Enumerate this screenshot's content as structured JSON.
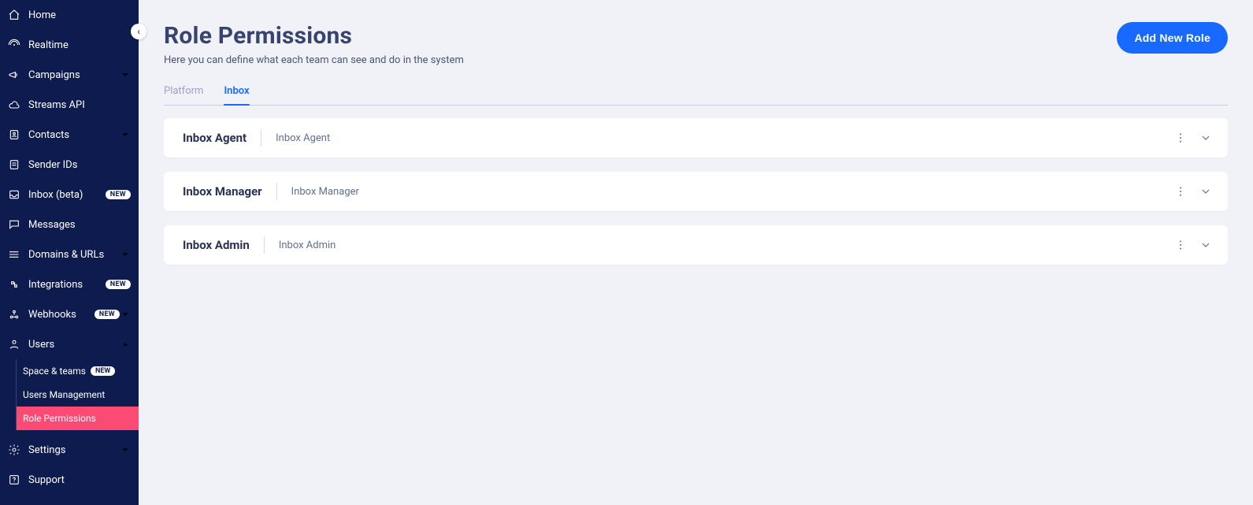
{
  "sidebar": {
    "collapse_icon": "‹",
    "items": [
      {
        "label": "Home",
        "icon": "home",
        "hasChevron": false
      },
      {
        "label": "Realtime",
        "icon": "realtime",
        "hasChevron": false
      },
      {
        "label": "Campaigns",
        "icon": "megaphone",
        "hasChevron": true
      },
      {
        "label": "Streams API",
        "icon": "cloud",
        "hasChevron": false
      },
      {
        "label": "Contacts",
        "icon": "contacts",
        "hasChevron": true
      },
      {
        "label": "Sender IDs",
        "icon": "sender",
        "hasChevron": false
      },
      {
        "label": "Inbox (beta)",
        "icon": "inbox",
        "hasChevron": false,
        "badge": "NEW"
      },
      {
        "label": "Messages",
        "icon": "messages",
        "hasChevron": false
      },
      {
        "label": "Domains & URLs",
        "icon": "domains",
        "hasChevron": true
      },
      {
        "label": "Integrations",
        "icon": "integrations",
        "hasChevron": false,
        "badge": "NEW"
      },
      {
        "label": "Webhooks",
        "icon": "webhooks",
        "hasChevron": true,
        "badge": "NEW"
      },
      {
        "label": "Users",
        "icon": "users",
        "hasChevron": true,
        "expanded": true,
        "children": [
          {
            "label": "Space & teams",
            "badge": "NEW"
          },
          {
            "label": "Users Management"
          },
          {
            "label": "Role Permissions",
            "active": true
          }
        ]
      },
      {
        "label": "Settings",
        "icon": "settings",
        "hasChevron": true
      },
      {
        "label": "Support",
        "icon": "support",
        "hasChevron": false
      }
    ]
  },
  "header": {
    "title": "Role Permissions",
    "subtitle": "Here you can define what each team can see and do in the system",
    "add_button": "Add New Role"
  },
  "tabs": [
    {
      "label": "Platform",
      "active": false
    },
    {
      "label": "Inbox",
      "active": true
    }
  ],
  "roles": [
    {
      "title": "Inbox Agent",
      "description": "Inbox Agent"
    },
    {
      "title": "Inbox Manager",
      "description": "Inbox Manager"
    },
    {
      "title": "Inbox Admin",
      "description": "Inbox Admin"
    }
  ]
}
